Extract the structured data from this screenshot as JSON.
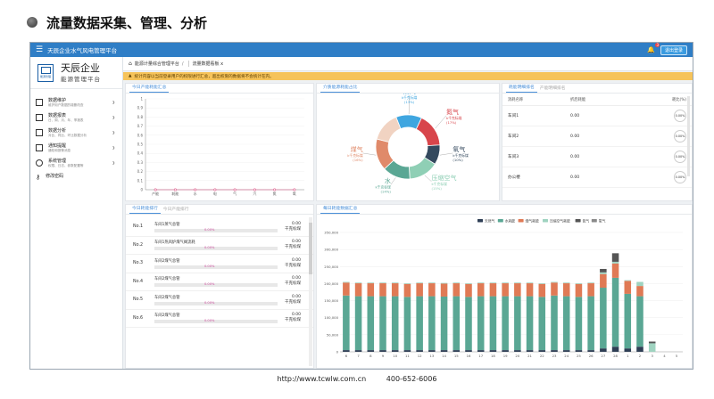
{
  "slide": {
    "title": "流量数据采集、管理、分析"
  },
  "app": {
    "title": "天辰企业水气风电管理平台",
    "logout": "退出登录",
    "badge": "3"
  },
  "logo": {
    "company": "天辰企业",
    "subtitle": "能源管理平台",
    "caption": "能源管理"
  },
  "nav": [
    {
      "title": "数据维护",
      "sub": "维护用户数据的增删改查"
    },
    {
      "title": "数据报表",
      "sub": "日、周、月、年、季报表"
    },
    {
      "title": "数据分析",
      "sub": "对比、同比、环比数据分析"
    },
    {
      "title": "通知提醒",
      "sub": "通知和报警消息"
    },
    {
      "title": "系统管理",
      "sub": "权限、日志、参数配置等"
    },
    {
      "title": "修改密码",
      "sub": ""
    }
  ],
  "breadcrumb": {
    "root": "能源计量综合管理平台",
    "current": "流量数据看板",
    "close": "x"
  },
  "notice": "统计内容以当前登录用户的权限进行汇总，超出权限的数据将不会统计在内。",
  "panels": {
    "line": {
      "tab": "今日产能耗能汇总"
    },
    "donut": {
      "tab": "介质能源耗能占比"
    },
    "table": {
      "tab1": "耗能明细排名",
      "tab2": "产能明细排名"
    },
    "rank": {
      "tab1": "今日耗能排行",
      "tab2": "今日产能排行"
    },
    "bar": {
      "tab": "每日耗能数据汇总"
    }
  },
  "ranking": [
    {
      "no": "No.1",
      "name": "车间1蒸气总管",
      "pct": "0.00%",
      "value": "0.00",
      "unit": "千克标煤"
    },
    {
      "no": "No.2",
      "name": "车间1热风炉煤气阀流耗",
      "pct": "0.00%",
      "value": "0.00",
      "unit": "千克标煤"
    },
    {
      "no": "No.3",
      "name": "车间2煤气总管",
      "pct": "0.00%",
      "value": "0.00",
      "unit": "千克标煤"
    },
    {
      "no": "No.4",
      "name": "车间2煤气总管",
      "pct": "0.00%",
      "value": "0.00",
      "unit": "千克标煤"
    },
    {
      "no": "No.5",
      "name": "车间2煤气总管",
      "pct": "0.00%",
      "value": "0.00",
      "unit": "千克标煤"
    },
    {
      "no": "No.6",
      "name": "车间2煤气总管",
      "pct": "0.00%",
      "value": "0.00",
      "unit": "千克标煤"
    }
  ],
  "detail_table": {
    "headers": [
      "消耗名称",
      "折后耗能",
      "耗比(%)"
    ],
    "rows": [
      {
        "name": "车间1",
        "value": "0.00",
        "ratio": "0.00%"
      },
      {
        "name": "车间2",
        "value": "0.00",
        "ratio": "0.00%"
      },
      {
        "name": "车间3",
        "value": "0.00",
        "ratio": "0.00%"
      },
      {
        "name": "办公楼",
        "value": "0.00",
        "ratio": "0.00%"
      }
    ]
  },
  "footer": {
    "url": "http://www.tcwlw.com.cn",
    "phone": "400-652-6006"
  },
  "chart_data": [
    {
      "type": "line",
      "categories": [
        "产能",
        "耗能",
        "水",
        "电",
        "气",
        "汽",
        "氮",
        "氧"
      ],
      "values": [
        0,
        0,
        0,
        0,
        0,
        0,
        0,
        0
      ],
      "ylim": [
        0,
        1
      ],
      "yticks": [
        "0",
        "0.1",
        "0.2",
        "0.3",
        "0.4",
        "0.5",
        "0.6",
        "0.7",
        "0.8",
        "0.9",
        "1"
      ],
      "color": "#e05a8a"
    },
    {
      "type": "pie",
      "slices": [
        {
          "name": "蒸汽",
          "unit": "k千克标煤",
          "pct": 13,
          "pct_label": "(13%)",
          "color": "#3fa6e0"
        },
        {
          "name": "氮气",
          "unit": "k千克标煤",
          "pct": 17,
          "pct_label": "(17%)",
          "color": "#d8454b"
        },
        {
          "name": "氧气",
          "unit": "k千克标煤",
          "pct": 10,
          "pct_label": "(10%)",
          "color": "#34495e"
        },
        {
          "name": "压缩空气",
          "unit": "k千克标煤",
          "pct": 15,
          "pct_label": "(15%)",
          "color": "#8fcfb5"
        },
        {
          "name": "水",
          "unit": "k千克标煤",
          "pct": 14,
          "pct_label": "(14%)",
          "color": "#5aa794"
        },
        {
          "name": "煤气",
          "unit": "k千克标煤",
          "pct": 16,
          "pct_label": "(16%)",
          "color": "#e08a6a"
        },
        {
          "name": "电",
          "unit": "",
          "pct": 15,
          "pct_label": "",
          "color": "#f1d3c2"
        }
      ]
    },
    {
      "type": "bar",
      "legend": [
        {
          "name": "天然气",
          "color": "#2e3e55"
        },
        {
          "name": "水耗能",
          "color": "#5aa794"
        },
        {
          "name": "煤气耗能",
          "color": "#e07a55"
        },
        {
          "name": "压缩空气耗能",
          "color": "#9fd3c0"
        },
        {
          "name": "氮气",
          "color": "#555555"
        },
        {
          "name": "氧气",
          "color": "#8a8a8a"
        }
      ],
      "categories": [
        "6",
        "7",
        "8",
        "9",
        "10",
        "11",
        "12",
        "13",
        "14",
        "15",
        "16",
        "17",
        "18",
        "19",
        "20",
        "21",
        "22",
        "23",
        "24",
        "25",
        "26",
        "27",
        "28",
        "1",
        "2",
        "3",
        "4",
        "5"
      ],
      "series": [
        {
          "name": "天然气",
          "values": [
            5000,
            5000,
            5000,
            5000,
            5000,
            5000,
            5000,
            5000,
            5000,
            5000,
            5000,
            5000,
            5000,
            5000,
            5000,
            5000,
            5000,
            5000,
            5000,
            5000,
            5000,
            10000,
            15000,
            10000,
            15000,
            0,
            0,
            0
          ]
        },
        {
          "name": "水耗能",
          "values": [
            160000,
            158000,
            158000,
            158000,
            158000,
            156000,
            158000,
            158000,
            157000,
            158000,
            156000,
            158000,
            158000,
            158000,
            158000,
            158000,
            156000,
            160000,
            158000,
            156000,
            158000,
            178000,
            202000,
            160000,
            148000,
            0,
            0,
            0
          ]
        },
        {
          "name": "煤气耗能",
          "values": [
            38000,
            38000,
            38000,
            38000,
            38000,
            38000,
            38000,
            38000,
            38000,
            38000,
            38000,
            38000,
            38000,
            38000,
            38000,
            38000,
            38000,
            38000,
            38000,
            38000,
            38000,
            40000,
            42000,
            38000,
            30000,
            0,
            0,
            0
          ]
        },
        {
          "name": "压缩空气耗能",
          "values": [
            2000,
            2000,
            2000,
            2000,
            2000,
            2000,
            2000,
            2000,
            2000,
            2000,
            2000,
            2000,
            2000,
            2000,
            2000,
            2000,
            2000,
            2000,
            2000,
            2000,
            2000,
            5000,
            5000,
            2000,
            12000,
            25000,
            0,
            0
          ]
        },
        {
          "name": "氮气",
          "values": [
            0,
            0,
            0,
            0,
            0,
            0,
            0,
            0,
            0,
            0,
            0,
            0,
            0,
            0,
            0,
            0,
            0,
            0,
            0,
            0,
            0,
            10000,
            25000,
            0,
            0,
            5000,
            0,
            0
          ]
        },
        {
          "name": "氧气",
          "values": [
            0,
            0,
            0,
            0,
            0,
            0,
            0,
            0,
            0,
            0,
            0,
            0,
            0,
            0,
            0,
            0,
            0,
            0,
            0,
            0,
            0,
            0,
            0,
            0,
            0,
            0,
            0,
            0
          ]
        }
      ],
      "ylim": [
        0,
        350000
      ],
      "yticks": [
        "0",
        "50,000",
        "100,000",
        "150,000",
        "200,000",
        "250,000",
        "300,000",
        "350,000"
      ]
    }
  ]
}
